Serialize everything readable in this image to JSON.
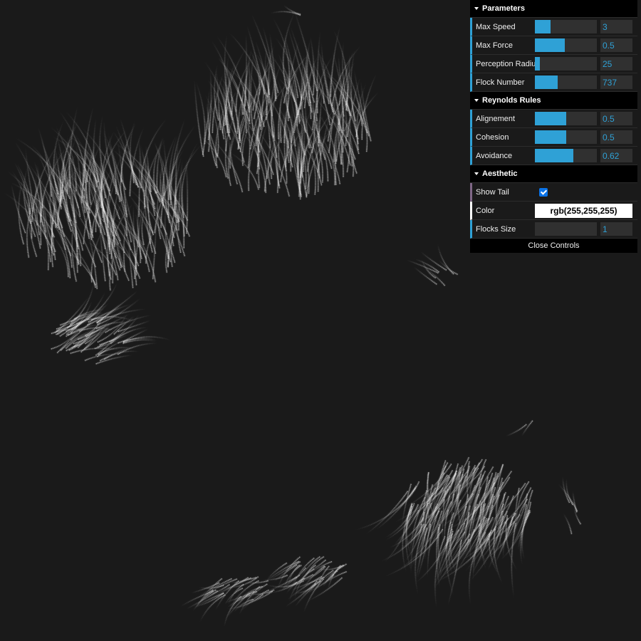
{
  "gui": {
    "folders": [
      {
        "title": "Parameters",
        "controls": [
          {
            "label": "Max Speed",
            "value": "3",
            "fill": 0.25
          },
          {
            "label": "Max Force",
            "value": "0.5",
            "fill": 0.48
          },
          {
            "label": "Perception Radius",
            "value": "25",
            "fill": 0.08
          },
          {
            "label": "Flock Number",
            "value": "737",
            "fill": 0.37
          }
        ]
      },
      {
        "title": "Reynolds Rules",
        "controls": [
          {
            "label": "Alignement",
            "value": "0.5",
            "fill": 0.5
          },
          {
            "label": "Cohesion",
            "value": "0.5",
            "fill": 0.5
          },
          {
            "label": "Avoidance",
            "value": "0.62",
            "fill": 0.62
          }
        ]
      },
      {
        "title": "Aesthetic",
        "show_tail": {
          "label": "Show Tail",
          "checked": true
        },
        "color": {
          "label": "Color",
          "value": "rgb(255,255,255)"
        },
        "flocks_size": {
          "label": "Flocks Size",
          "value": "1",
          "fill": 0.0
        }
      }
    ],
    "close_label": "Close Controls"
  },
  "colors": {
    "background": "#1a1a1a",
    "accent": "#2fa1d6",
    "boid": "#ffffff"
  }
}
